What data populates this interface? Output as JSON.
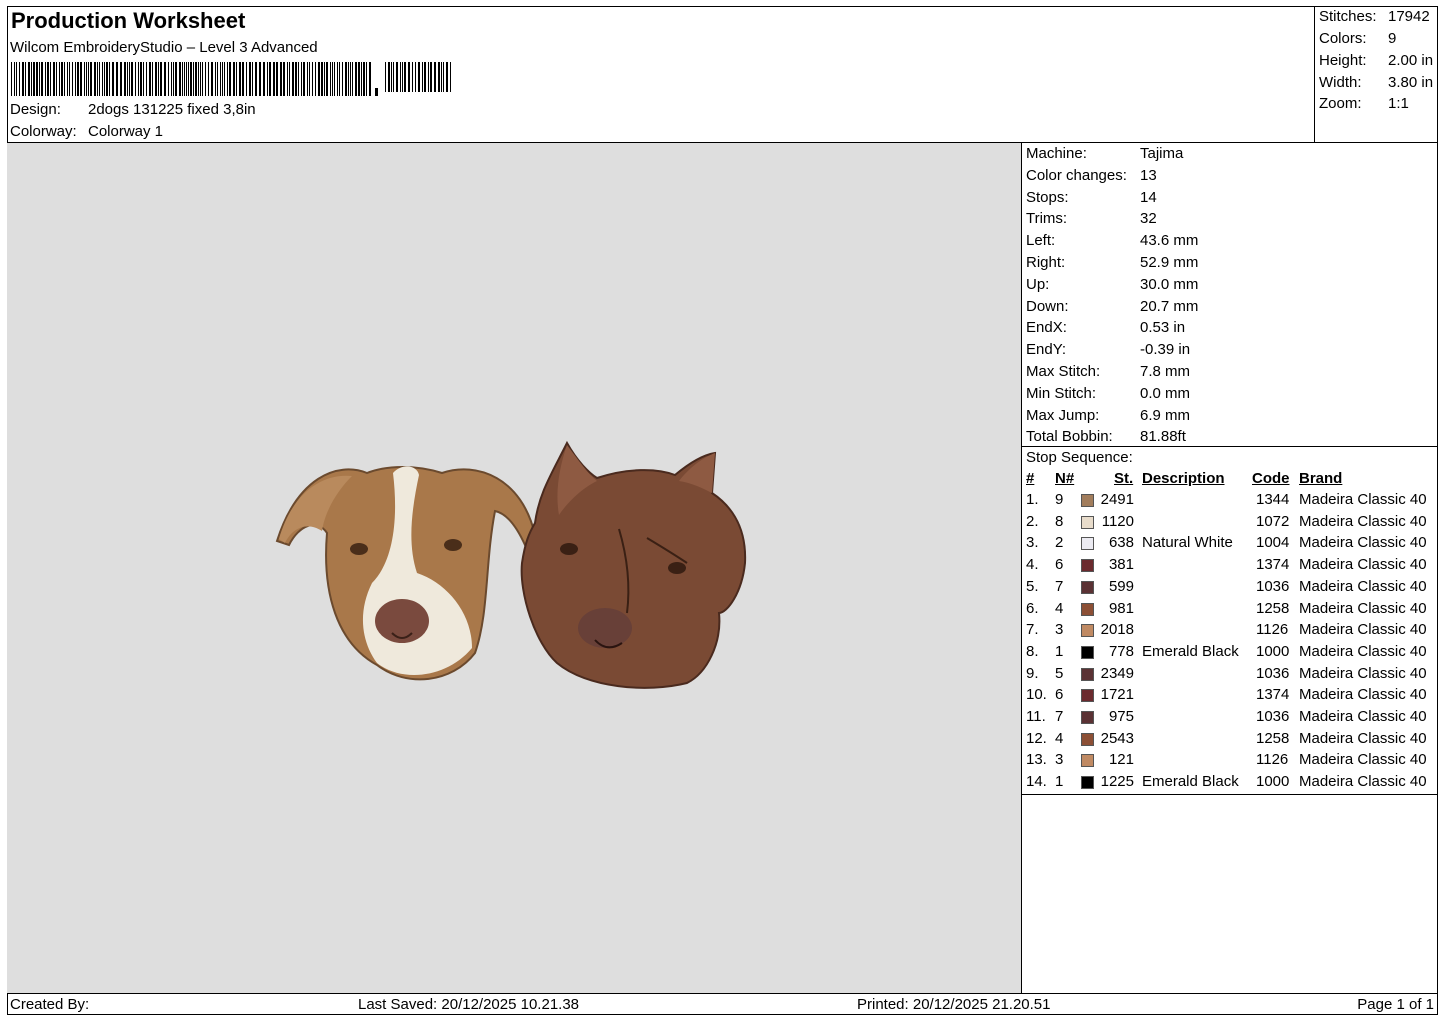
{
  "header": {
    "title": "Production Worksheet",
    "subtitle": "Wilcom EmbroideryStudio – Level 3 Advanced",
    "design_label": "Design:",
    "design_value": "2dogs 131225 fixed 3,8in",
    "colorway_label": "Colorway:",
    "colorway_value": "Colorway 1"
  },
  "stats": [
    {
      "label": "Stitches:",
      "value": "17942"
    },
    {
      "label": "Colors:",
      "value": "9"
    },
    {
      "label": "Height:",
      "value": "2.00 in"
    },
    {
      "label": "Width:",
      "value": "3.80 in"
    },
    {
      "label": "Zoom:",
      "value": "1:1"
    }
  ],
  "machine": [
    {
      "label": "Machine:",
      "value": "Tajima"
    },
    {
      "label": "Color changes:",
      "value": "13"
    },
    {
      "label": "Stops:",
      "value": "14"
    },
    {
      "label": "Trims:",
      "value": "32"
    },
    {
      "label": "Left:",
      "value": "43.6 mm"
    },
    {
      "label": "Right:",
      "value": "52.9 mm"
    },
    {
      "label": "Up:",
      "value": "30.0 mm"
    },
    {
      "label": "Down:",
      "value": "20.7 mm"
    },
    {
      "label": "EndX:",
      "value": "0.53 in"
    },
    {
      "label": "EndY:",
      "value": "-0.39 in"
    },
    {
      "label": "Max Stitch:",
      "value": "7.8 mm"
    },
    {
      "label": "Min Stitch:",
      "value": "0.0 mm"
    },
    {
      "label": "Max Jump:",
      "value": "6.9 mm"
    },
    {
      "label": "Total Bobbin:",
      "value": "81.88ft"
    }
  ],
  "sequence": {
    "title": "Stop Sequence:",
    "headers": {
      "num": "#",
      "needle": "N#",
      "stitches": "St.",
      "description": "Description",
      "code": "Code",
      "brand": "Brand"
    },
    "rows": [
      {
        "num": "1.",
        "needle": "9",
        "color": "#a27d5c",
        "stitches": "2491",
        "description": "",
        "code": "1344",
        "brand": "Madeira Classic 40"
      },
      {
        "num": "2.",
        "needle": "8",
        "color": "#e8dccb",
        "stitches": "1120",
        "description": "",
        "code": "1072",
        "brand": "Madeira Classic 40"
      },
      {
        "num": "3.",
        "needle": "2",
        "color": "#ecebf2",
        "stitches": "638",
        "description": "Natural White",
        "code": "1004",
        "brand": "Madeira Classic 40"
      },
      {
        "num": "4.",
        "needle": "6",
        "color": "#6b2a2e",
        "stitches": "381",
        "description": "",
        "code": "1374",
        "brand": "Madeira Classic 40"
      },
      {
        "num": "5.",
        "needle": "7",
        "color": "#5b3234",
        "stitches": "599",
        "description": "",
        "code": "1036",
        "brand": "Madeira Classic 40"
      },
      {
        "num": "6.",
        "needle": "4",
        "color": "#8c4f35",
        "stitches": "981",
        "description": "",
        "code": "1258",
        "brand": "Madeira Classic 40"
      },
      {
        "num": "7.",
        "needle": "3",
        "color": "#c08a63",
        "stitches": "2018",
        "description": "",
        "code": "1126",
        "brand": "Madeira Classic 40"
      },
      {
        "num": "8.",
        "needle": "1",
        "color": "#000000",
        "stitches": "778",
        "description": "Emerald Black",
        "code": "1000",
        "brand": "Madeira Classic 40"
      },
      {
        "num": "9.",
        "needle": "5",
        "color": "#5b3234",
        "stitches": "2349",
        "description": "",
        "code": "1036",
        "brand": "Madeira Classic 40"
      },
      {
        "num": "10.",
        "needle": "6",
        "color": "#6b2a2e",
        "stitches": "1721",
        "description": "",
        "code": "1374",
        "brand": "Madeira Classic 40"
      },
      {
        "num": "11.",
        "needle": "7",
        "color": "#5b3234",
        "stitches": "975",
        "description": "",
        "code": "1036",
        "brand": "Madeira Classic 40"
      },
      {
        "num": "12.",
        "needle": "4",
        "color": "#8c4f35",
        "stitches": "2543",
        "description": "",
        "code": "1258",
        "brand": "Madeira Classic 40"
      },
      {
        "num": "13.",
        "needle": "3",
        "color": "#c08a63",
        "stitches": "121",
        "description": "",
        "code": "1126",
        "brand": "Madeira Classic 40"
      },
      {
        "num": "14.",
        "needle": "1",
        "color": "#000000",
        "stitches": "1225",
        "description": "Emerald Black",
        "code": "1000",
        "brand": "Madeira Classic 40"
      }
    ]
  },
  "footer": {
    "created_by": "Created By:",
    "last_saved": "Last Saved: 20/12/2025 10.21.38",
    "printed": "Printed: 20/12/2025 21.20.51",
    "page": "Page 1 of 1"
  }
}
